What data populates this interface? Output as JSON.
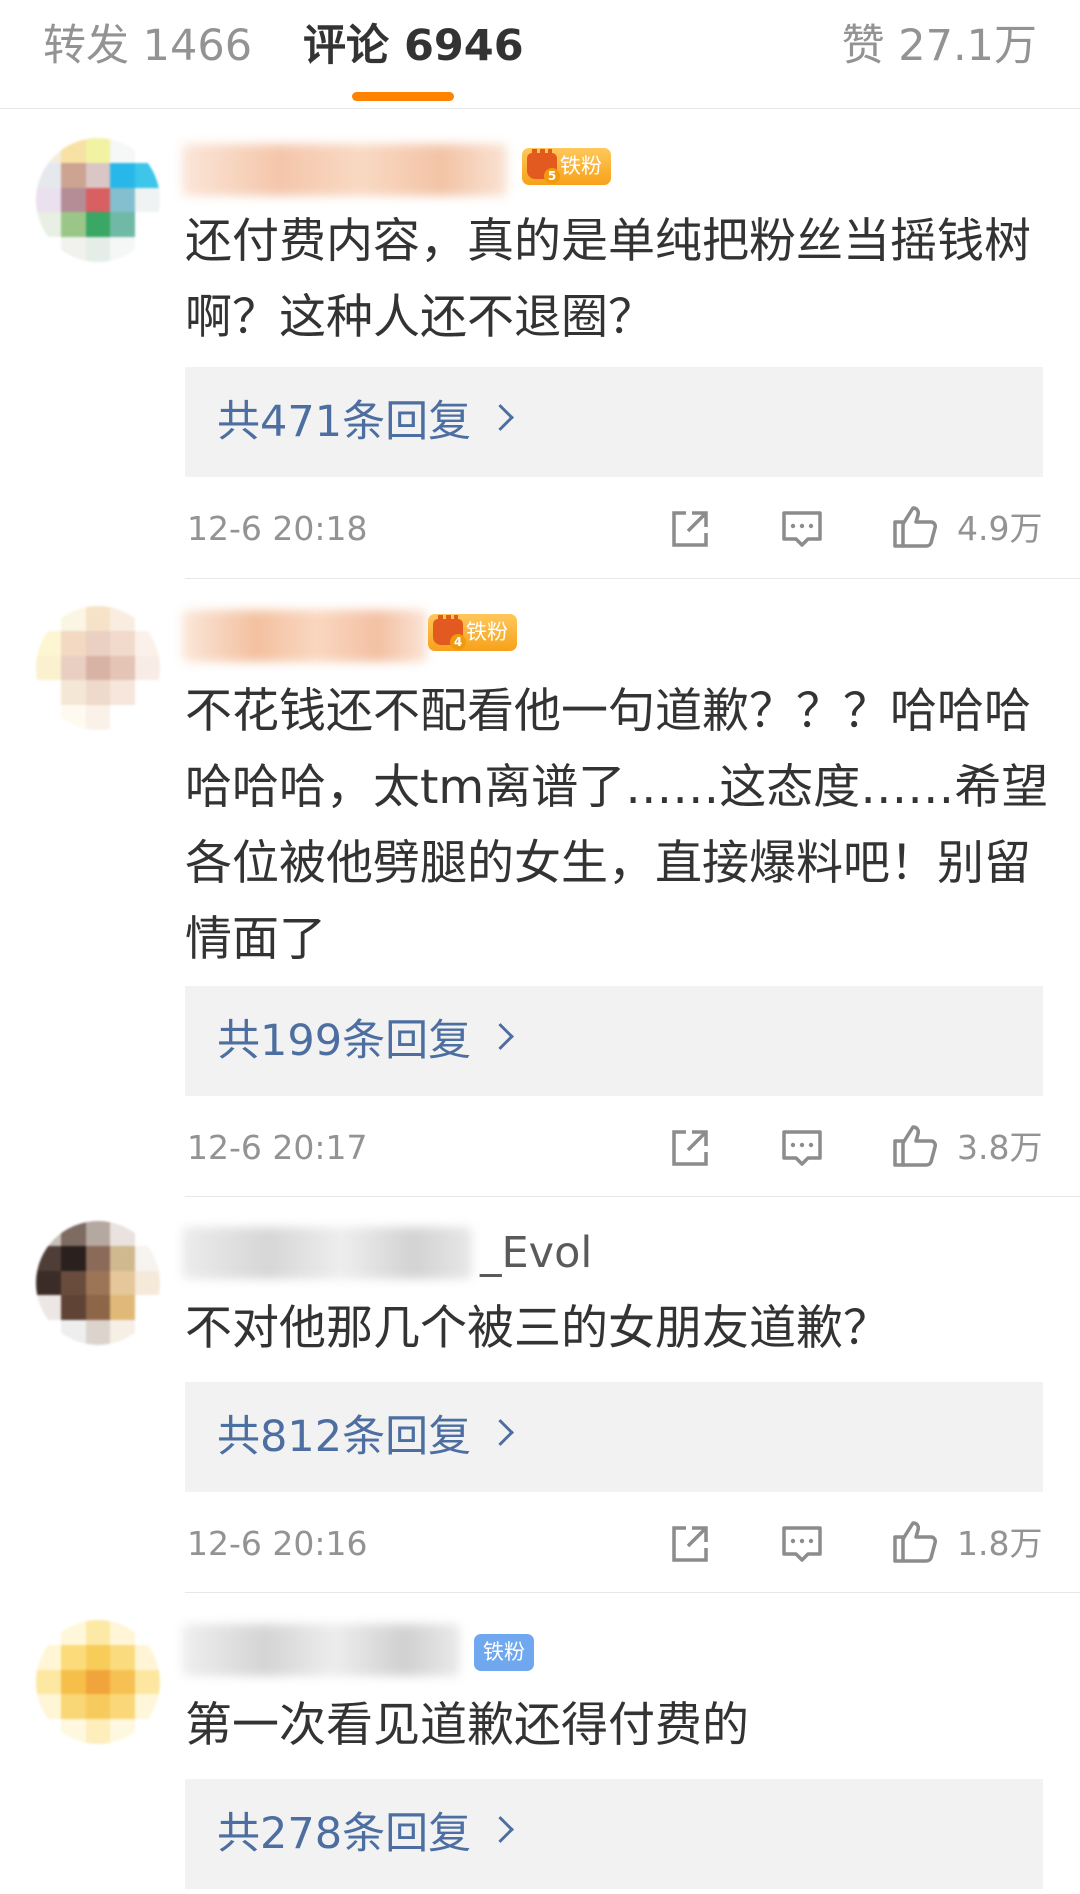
{
  "tabs": {
    "repost": "转发 1466",
    "comments": "评论 6946",
    "likes": "赞 27.1万"
  },
  "colors": {
    "accent": "#ff8200",
    "link": "#4c6ea0",
    "muted": "#939393",
    "reply_bg": "#f2f2f2"
  },
  "comments": [
    {
      "username_visible": "",
      "badge": "铁粉",
      "badge_level": "5",
      "text": "还付费内容，真的是单纯把粉丝当摇钱树啊？这种人还不退圈？",
      "replies": "共471条回复",
      "time": "12-6 20:18",
      "likes": "4.9万"
    },
    {
      "username_visible": "",
      "badge": "铁粉",
      "badge_level": "4",
      "text": "不花钱还不配看他一句道歉？？？哈哈哈哈哈哈，太tm离谱了……这态度……希望各位被他劈腿的女生，直接爆料吧！别留情面了",
      "replies": "共199条回复",
      "time": "12-6 20:17",
      "likes": "3.8万"
    },
    {
      "username_visible": "_Evol",
      "badge": "",
      "badge_level": "",
      "text": "不对他那几个被三的女朋友道歉？",
      "replies": "共812条回复",
      "time": "12-6 20:16",
      "likes": "1.8万"
    },
    {
      "username_visible": "",
      "badge": "铁粉",
      "badge_level": "",
      "text": "第一次看见道歉还得付费的",
      "replies": "共278条回复",
      "time": "",
      "likes": ""
    }
  ],
  "icons": {
    "share": "share-icon",
    "comment": "comment-icon",
    "like": "thumbs-up-icon",
    "chevron": "chevron-right-icon"
  }
}
